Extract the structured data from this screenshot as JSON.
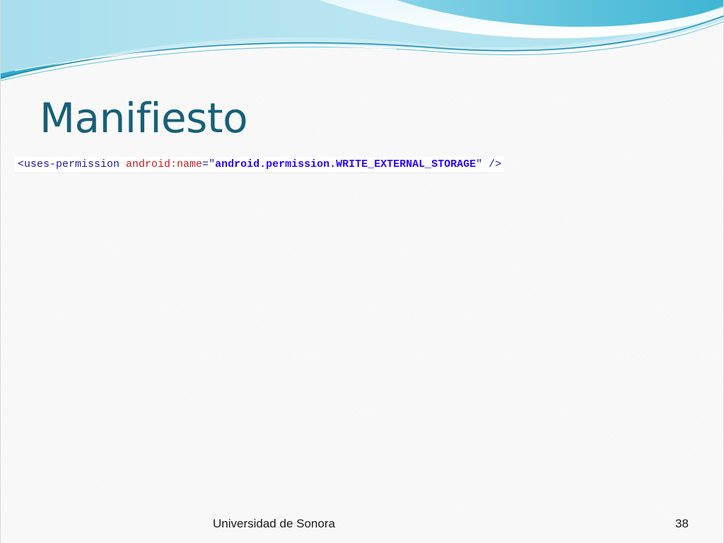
{
  "slide": {
    "title": "Manifiesto",
    "code": {
      "tag_open": "<uses-permission ",
      "attr_name": "android:name",
      "equals": "=\"",
      "attr_value": "android.permission.WRITE_EXTERNAL_STORAGE",
      "tag_close": "\" />"
    },
    "footer": "Universidad de Sonora",
    "page_number": "38"
  },
  "colors": {
    "title": "#17607a",
    "wave_light": "#bfe8f2",
    "wave_mid": "#5cc4dc",
    "wave_dark": "#1a8db0"
  }
}
